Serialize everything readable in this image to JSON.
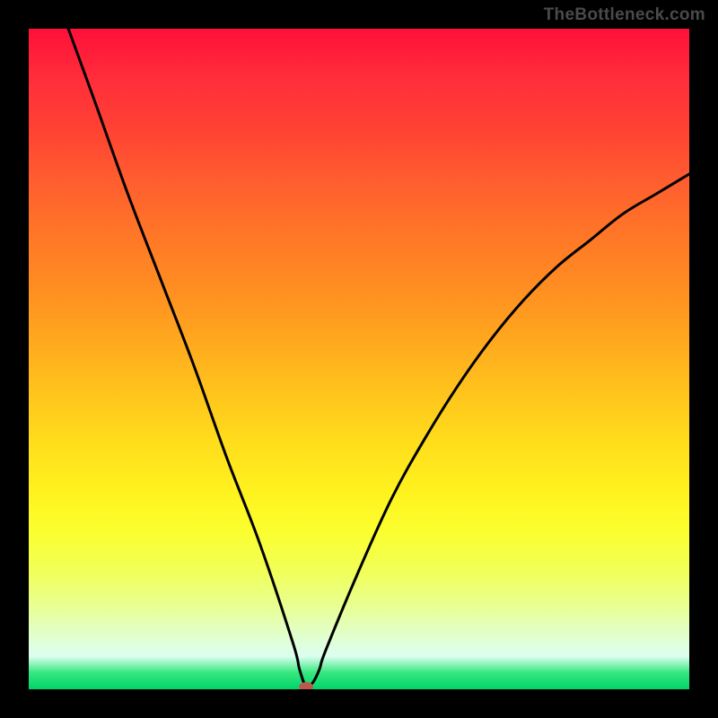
{
  "watermark": "TheBottleneck.com",
  "chart_data": {
    "type": "line",
    "title": "",
    "xlabel": "",
    "ylabel": "",
    "xlim": [
      0,
      100
    ],
    "ylim": [
      0,
      100
    ],
    "colors": {
      "top": "#ff103a",
      "mid": "#fff21e",
      "bottom": "#00d46a",
      "line": "#000000",
      "frame": "#000000"
    },
    "series": [
      {
        "name": "curve",
        "x": [
          6,
          10,
          15,
          20,
          25,
          30,
          35,
          40,
          41,
          42,
          43,
          44,
          45,
          50,
          55,
          60,
          65,
          70,
          75,
          80,
          85,
          90,
          95,
          100
        ],
        "y": [
          100,
          89,
          75,
          62,
          49,
          35,
          22,
          7,
          3,
          0.4,
          1,
          3,
          6,
          18,
          29,
          38,
          46,
          53,
          59,
          64,
          68,
          72,
          75,
          78
        ]
      }
    ],
    "minimum_marker": {
      "x": 42,
      "y": 0.4,
      "color": "#bd584f"
    }
  }
}
